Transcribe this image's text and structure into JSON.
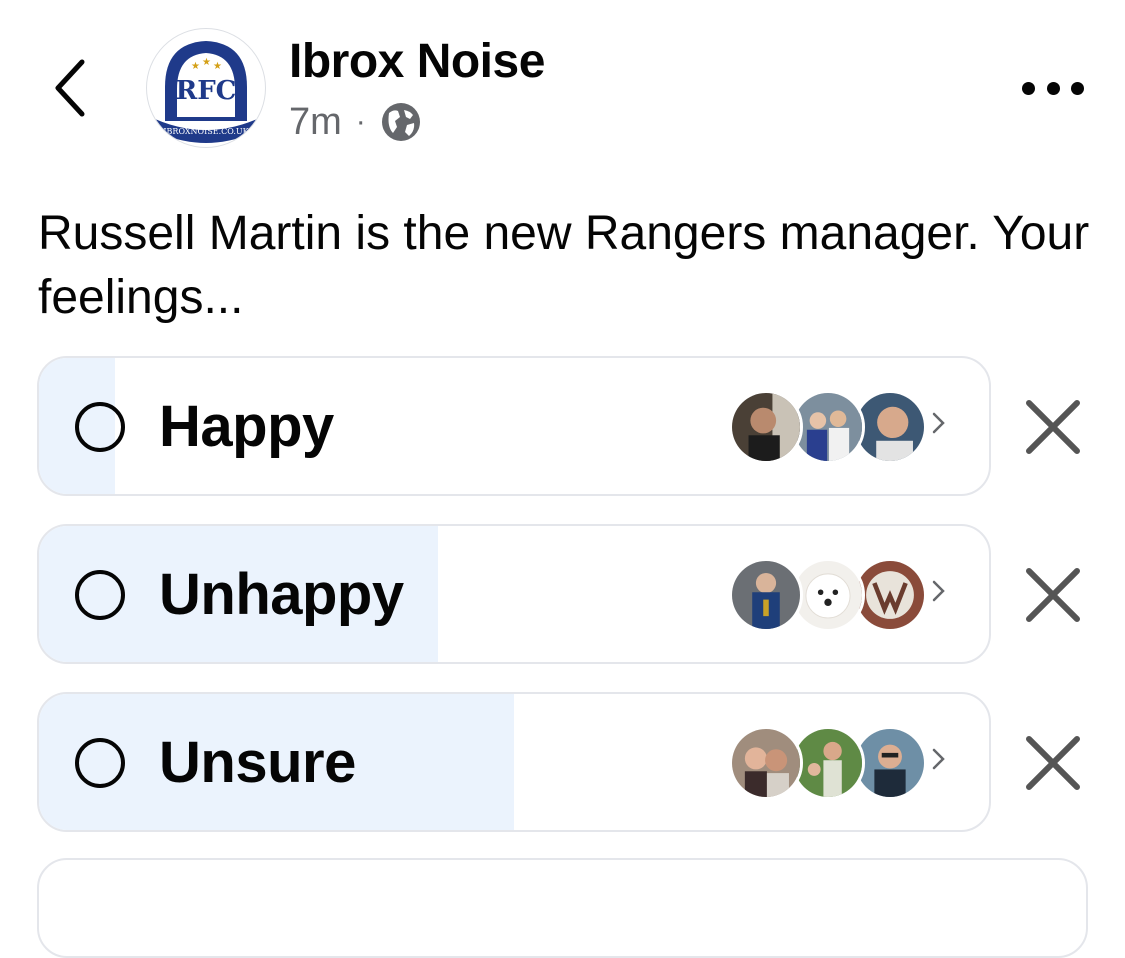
{
  "header": {
    "page_name": "Ibrox Noise",
    "time_ago": "7m",
    "separator": "·",
    "audience_icon": "globe-icon",
    "logo_text": "IBROXNOISE.CO.UK",
    "logo_monogram": "RFC"
  },
  "post": {
    "text": "Russell Martin is the new Rangers manager. Your feelings..."
  },
  "poll": {
    "options": [
      {
        "label": "Happy",
        "vote_share": 0.08
      },
      {
        "label": "Unhappy",
        "vote_share": 0.42
      },
      {
        "label": "Unsure",
        "vote_share": 0.5
      }
    ]
  },
  "colors": {
    "poll_fill": "#ebf3fd",
    "border": "#e4e6eb",
    "secondary_text": "#65676b",
    "logo_navy": "#1f3a8a"
  }
}
